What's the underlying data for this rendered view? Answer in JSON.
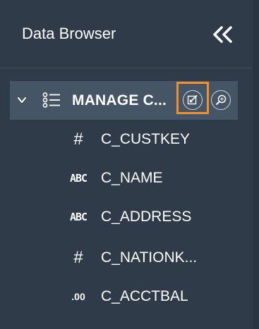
{
  "panel": {
    "title": "Data Browser",
    "collapse_icon": "double-chevron-left-icon"
  },
  "table": {
    "name": "MANAGE C...",
    "expand_icon": "chevron-down-icon",
    "type_icon": "list-icon",
    "edit_icon": "edit-icon",
    "search_icon": "search-icon",
    "highlight_color": "#f1902c"
  },
  "columns": [
    {
      "type": "#",
      "name": "C_CUSTKEY"
    },
    {
      "type": "ABC",
      "name": "C_NAME"
    },
    {
      "type": "ABC",
      "name": "C_ADDRESS"
    },
    {
      "type": "#",
      "name": "C_NATIONK..."
    },
    {
      "type": ".00",
      "name": "C_ACCTBAL"
    }
  ],
  "colors": {
    "background": "#2f3b49",
    "selected_row": "#465565",
    "text": "#ffffff"
  }
}
